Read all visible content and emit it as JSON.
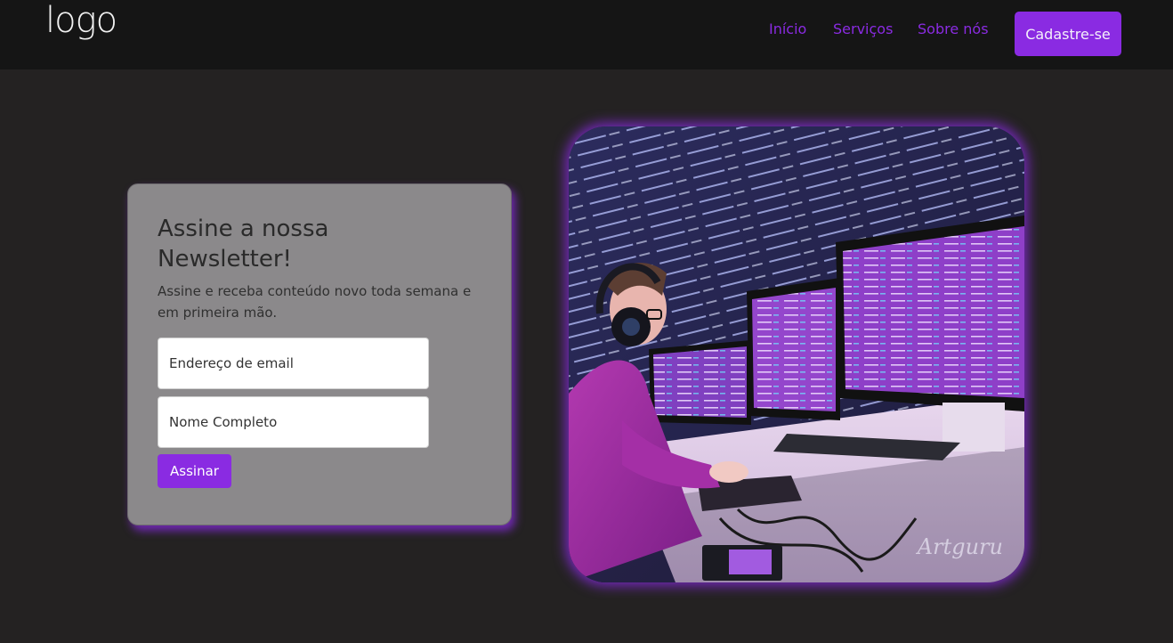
{
  "header": {
    "logo": "logo",
    "nav": [
      {
        "label": "Início"
      },
      {
        "label": "Serviços"
      },
      {
        "label": "Sobre nós"
      }
    ],
    "cta_label": "Cadastre-se"
  },
  "newsletter": {
    "title": "Assine a nossa Newsletter!",
    "subtitle": "Assine e receba conteúdo novo toda semana e em primeira mão.",
    "email_placeholder": "Endereço de email",
    "name_placeholder": "Nome Completo",
    "submit_label": "Assinar"
  },
  "hero": {
    "watermark": "Artguru"
  },
  "colors": {
    "accent": "#8a2be2",
    "background": "#242222",
    "header": "#151515",
    "card": "#8b898b"
  }
}
